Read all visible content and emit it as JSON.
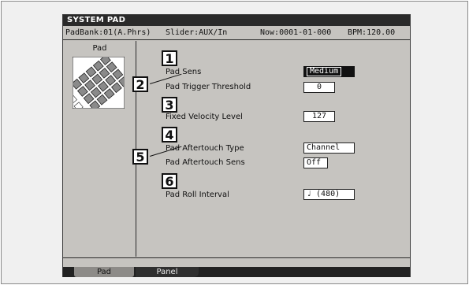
{
  "screen": {
    "title": "SYSTEM PAD",
    "status": {
      "padbank": "PadBank:01(A.Phrs)",
      "slider": "Slider:AUX/In",
      "now": "Now:0001-01-000",
      "bpm": "BPM:120.00"
    }
  },
  "left_panel": {
    "title": "Pad"
  },
  "params": [
    {
      "label": "Pad Sens",
      "value": "Medium"
    },
    {
      "label": "Pad Trigger Threshold",
      "value": "0"
    },
    {
      "label": "Fixed Velocity Level",
      "value": "127"
    },
    {
      "label": "Pad Aftertouch Type",
      "value": "Channel"
    },
    {
      "label": "Pad Aftertouch Sens",
      "value": "Off"
    },
    {
      "label": "Pad Roll Interval",
      "value": "♩ (480)"
    }
  ],
  "callouts": [
    "1",
    "2",
    "3",
    "4",
    "5",
    "6"
  ],
  "tabs": [
    "Pad",
    "Panel"
  ],
  "colors": {
    "screen_bg": "#c6c4c0",
    "title_bg": "#2a2a2a",
    "selected_bg": "#111111"
  }
}
